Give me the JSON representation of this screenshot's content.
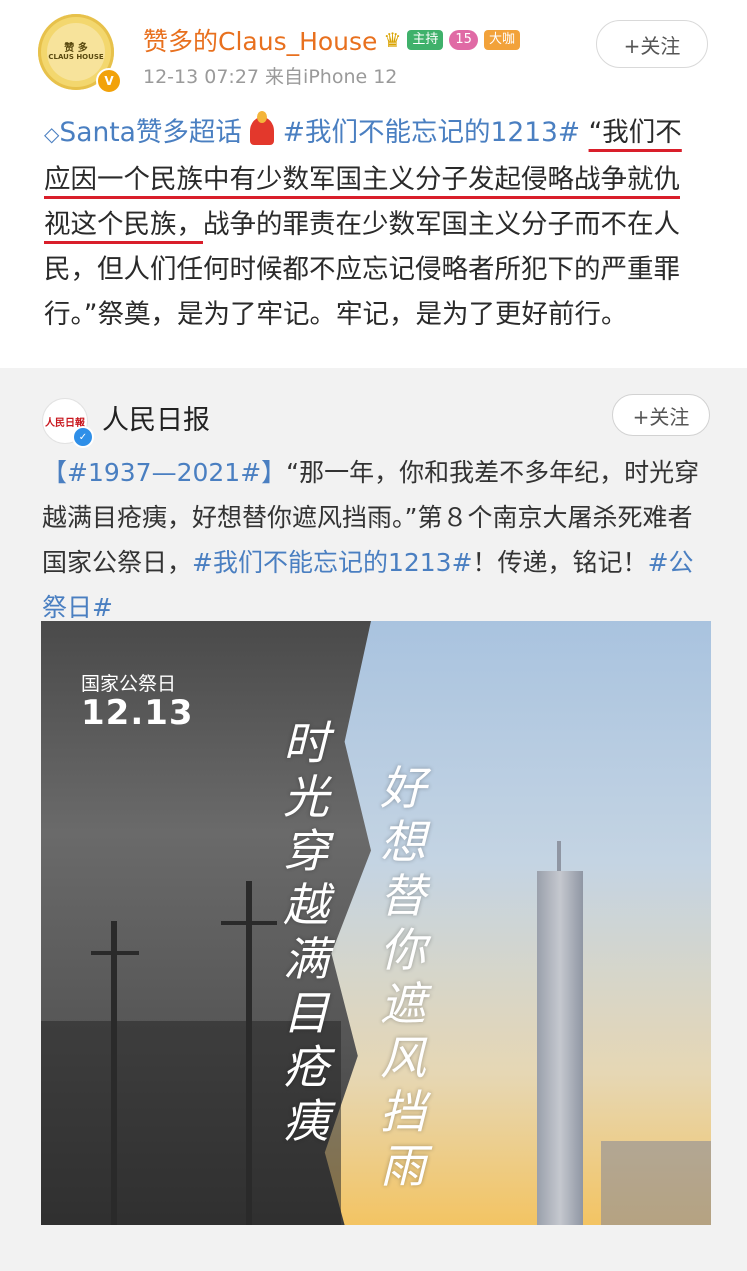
{
  "post": {
    "username": "赞多的Claus_House",
    "avatar_text_1": "赞 多",
    "avatar_text_2": "CLAUS HOUSE",
    "badges": {
      "host": "主持",
      "gem": "15",
      "big": "大咖"
    },
    "meta": "12-13 07:27  来自iPhone 12",
    "follow_label": "+关注",
    "topic_prefix": "Santa赞多超话",
    "hashtag": "#我们不能忘记的1213#",
    "quote_underlined": "“我们不应因一个民族中有少数军国主义分子发起侵略战争就仇视这个民族，",
    "quote_rest": "战争的罪责在少数军国主义分子而不在人民，但人们任何时候都不应忘记侵略者所犯下的严重罪行。”祭奠，是为了牢记。牢记，是为了更好前行。"
  },
  "repost": {
    "name": "人民日报",
    "avatar_text": "人民日報",
    "follow_label": "+关注",
    "tag1": "【#1937—2021#】",
    "text1": "“那一年，你和我差不多年纪，时光穿越满目疮痍，好想替你遮风挡雨。”第８个南京大屠杀死难者国家公祭日，",
    "tag2": "#我们不能忘记的1213#",
    "text2": "！传递，铭记！",
    "tag3": "#公祭日#",
    "poster": {
      "label": "国家公祭日",
      "date": "12.13",
      "calligraphy_left": "时光穿越满目疮痍",
      "calligraphy_right": "好想替你遮风挡雨"
    }
  },
  "colors": {
    "accent_orange": "#e8701e",
    "link_blue": "#4a7fc1",
    "underline_red": "#d91e2a"
  }
}
